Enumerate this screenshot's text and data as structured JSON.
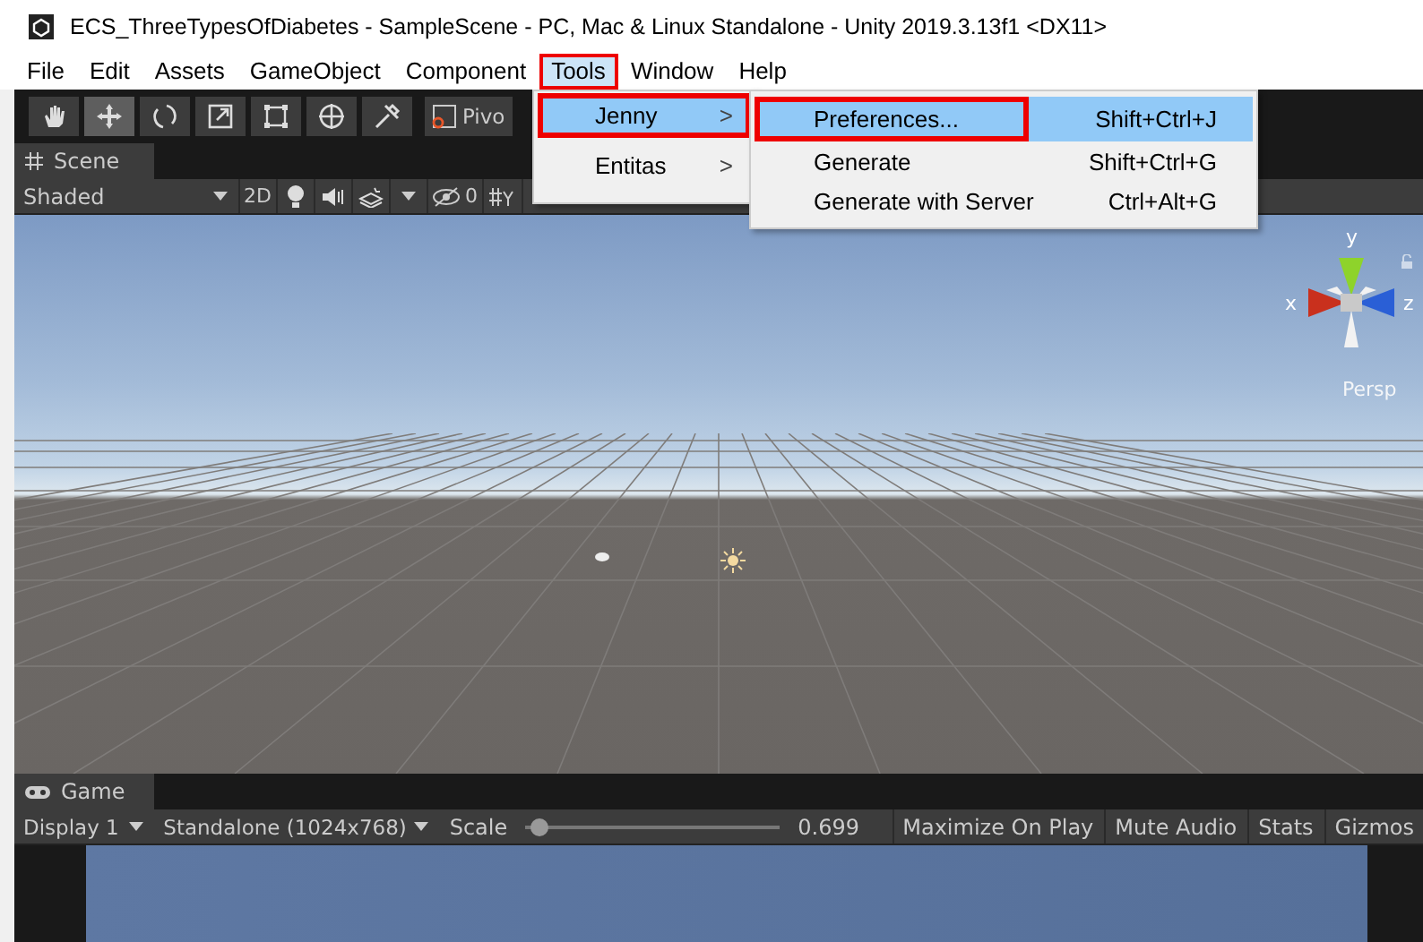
{
  "window": {
    "title": "ECS_ThreeTypesOfDiabetes - SampleScene - PC, Mac & Linux Standalone - Unity 2019.3.13f1 <DX11>"
  },
  "menu_bar": [
    {
      "label": "File",
      "open": false,
      "annotated": false
    },
    {
      "label": "Edit",
      "open": false,
      "annotated": false
    },
    {
      "label": "Assets",
      "open": false,
      "annotated": false
    },
    {
      "label": "GameObject",
      "open": false,
      "annotated": false
    },
    {
      "label": "Component",
      "open": false,
      "annotated": false
    },
    {
      "label": "Tools",
      "open": true,
      "annotated": true
    },
    {
      "label": "Window",
      "open": false,
      "annotated": false
    },
    {
      "label": "Help",
      "open": false,
      "annotated": false
    }
  ],
  "tools_menu": [
    {
      "label": "Jenny",
      "arrow": ">",
      "selected": true,
      "annotated": true
    },
    {
      "label": "Entitas",
      "arrow": ">",
      "selected": false,
      "annotated": false
    }
  ],
  "jenny_submenu": [
    {
      "label": "Preferences...",
      "shortcut": "Shift+Ctrl+J",
      "selected": true,
      "annotated": true
    },
    {
      "label": "Generate",
      "shortcut": "Shift+Ctrl+G",
      "selected": false,
      "annotated": false
    },
    {
      "label": "Generate with Server",
      "shortcut": "Ctrl+Alt+G",
      "selected": false,
      "annotated": false
    }
  ],
  "toolbar": {
    "tools": [
      {
        "kind": "hand",
        "selected": false
      },
      {
        "kind": "move",
        "selected": true
      },
      {
        "kind": "rotate",
        "selected": false
      },
      {
        "kind": "scale",
        "selected": false
      },
      {
        "kind": "rect",
        "selected": false
      },
      {
        "kind": "transform",
        "selected": false
      },
      {
        "kind": "custom",
        "selected": false
      }
    ],
    "pivot": "Pivo"
  },
  "scene": {
    "tab": "Scene",
    "shading": "Shaded",
    "mode_2d": "2D",
    "hidden_count": "0",
    "gizmo": {
      "y": "y",
      "x": "x",
      "z": "z",
      "projection": "Persp"
    }
  },
  "game": {
    "tab": "Game",
    "display": "Display 1",
    "resolution": "Standalone (1024x768)",
    "scale_label": "Scale",
    "scale": {
      "level": 0.03
    },
    "scale_value": "0.699",
    "buttons": [
      "Maximize On Play",
      "Mute Audio",
      "Stats",
      "Gizmos"
    ]
  }
}
